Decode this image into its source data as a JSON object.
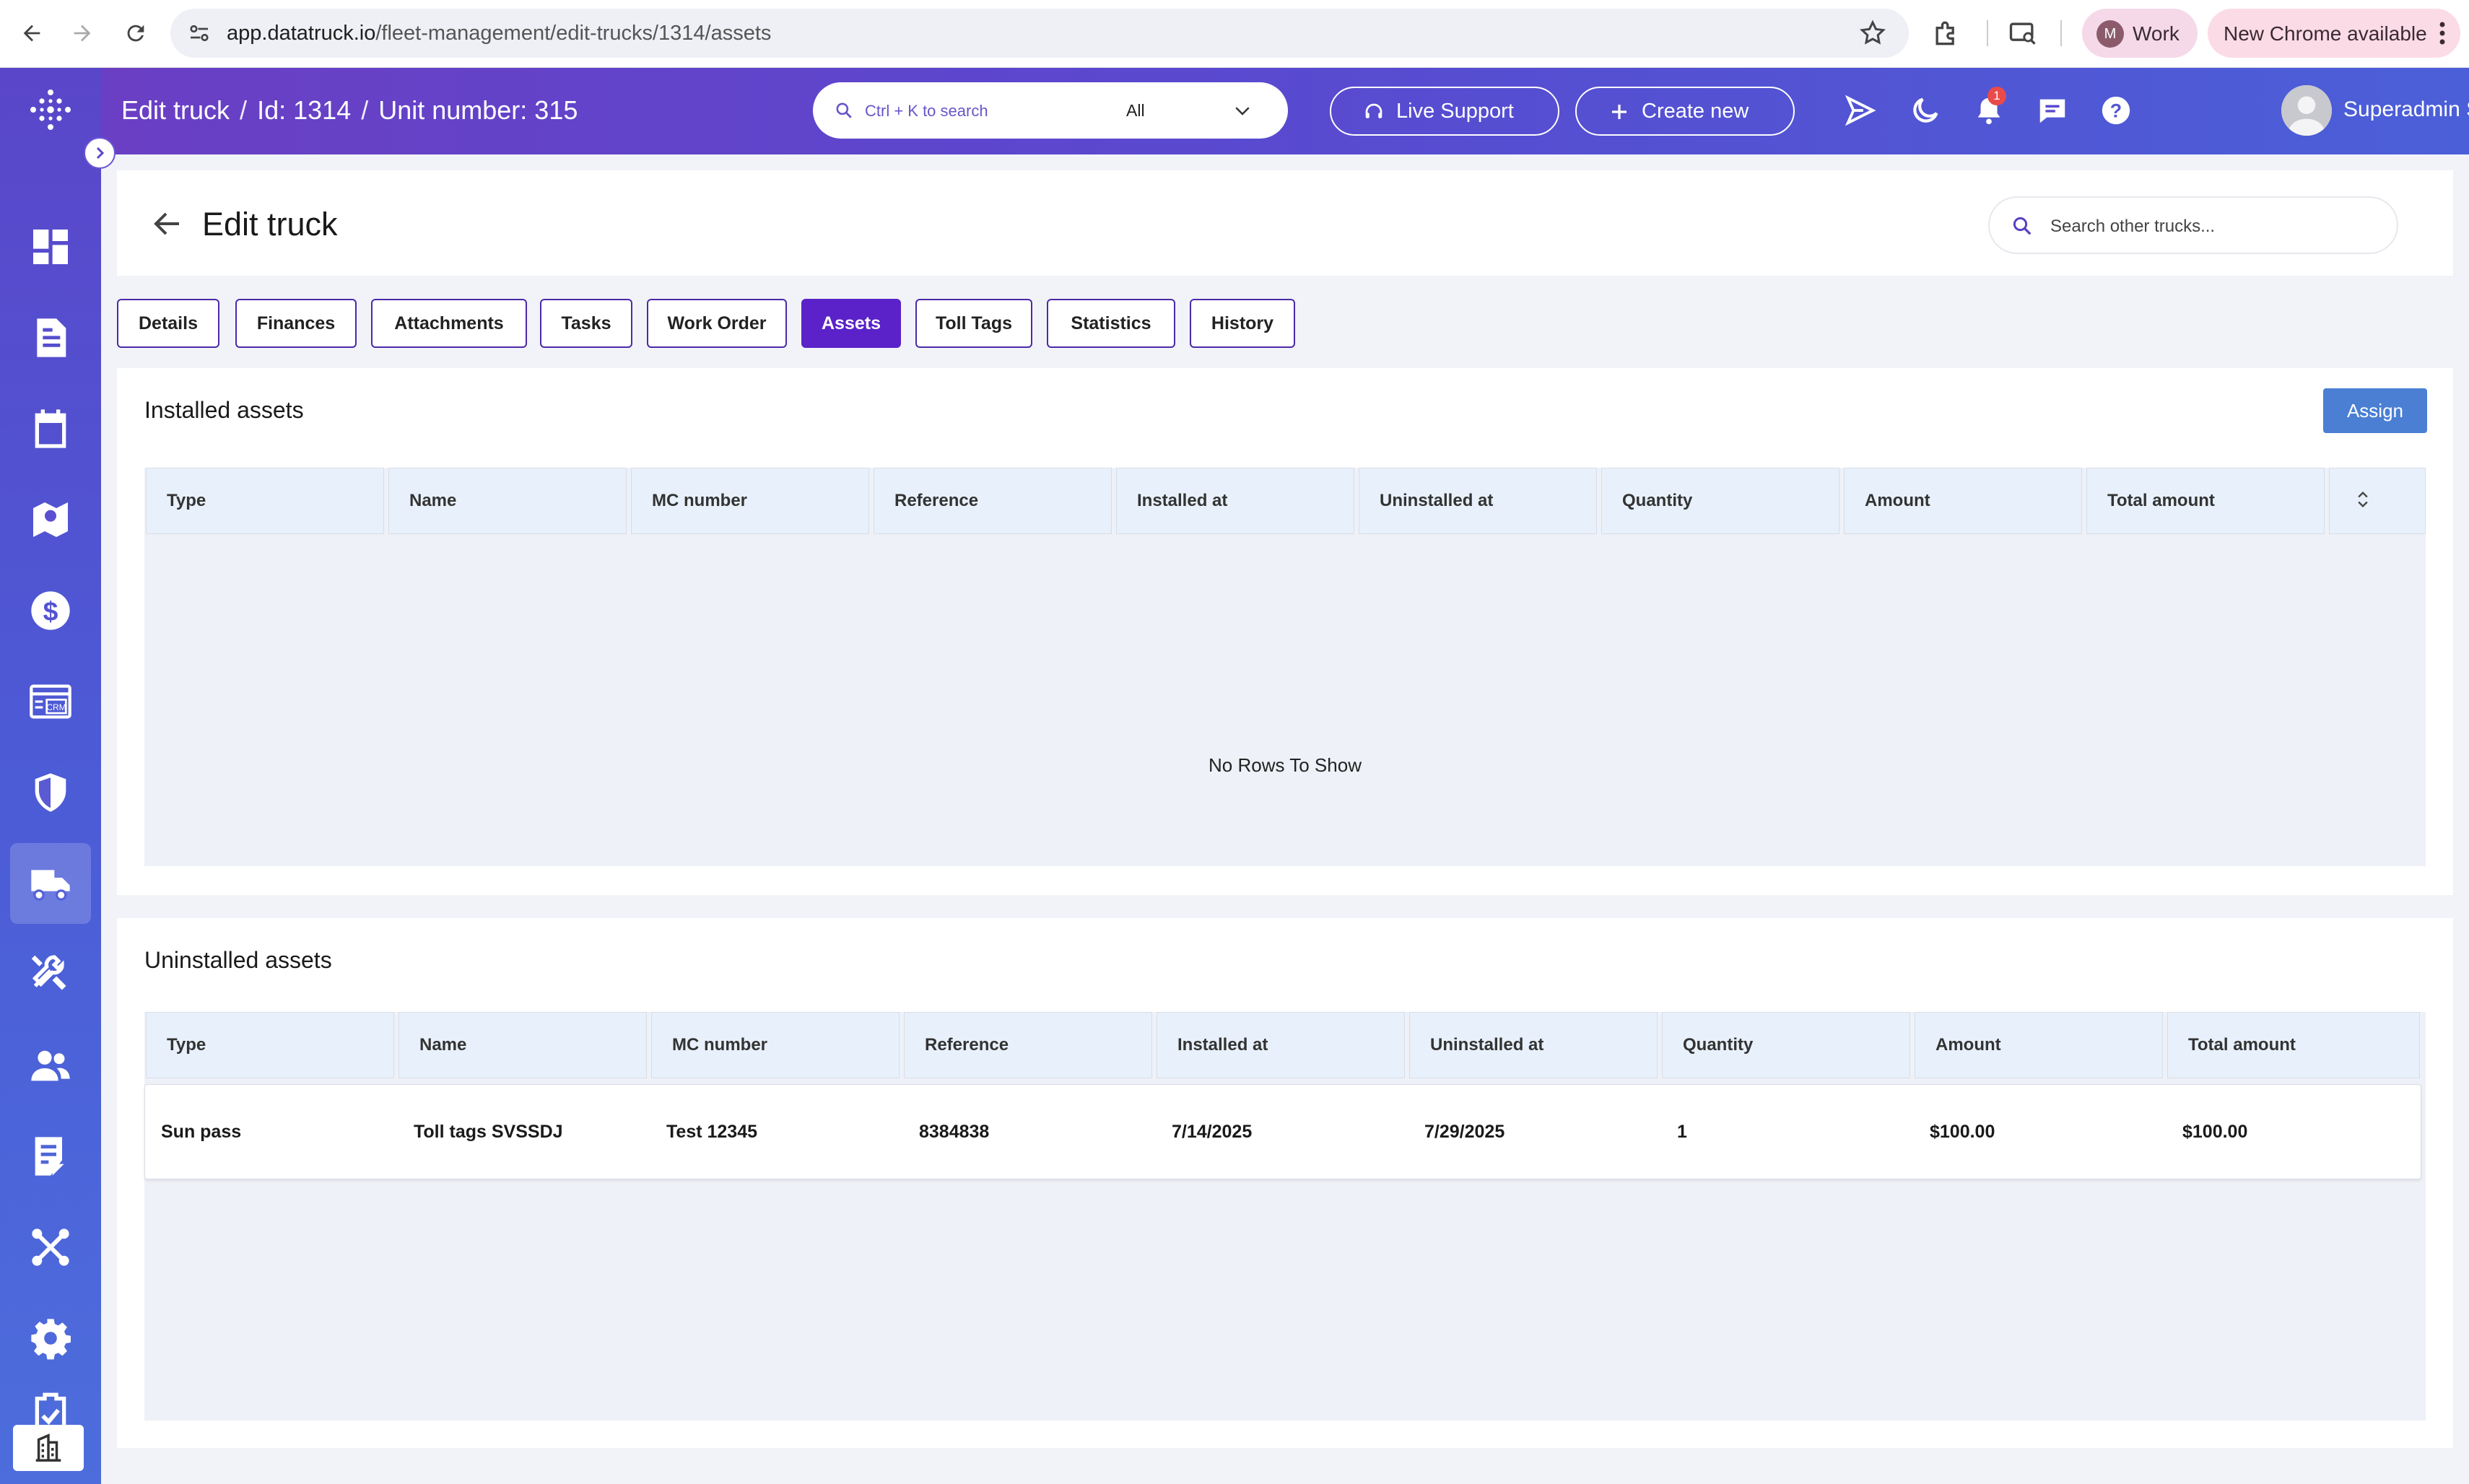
{
  "browser": {
    "url_host": "app.datatruck.io",
    "url_path": "/fleet-management/edit-trucks/1314/assets",
    "profile_initial": "M",
    "profile_label": "Work",
    "update_label": "New Chrome available"
  },
  "header": {
    "breadcrumb": [
      "Edit truck",
      "Id: 1314",
      "Unit number: 315"
    ],
    "search_placeholder": "Ctrl + K to search",
    "search_scope": "All",
    "live_support_label": "Live Support",
    "create_new_label": "Create new",
    "notification_count": "1",
    "user_name": "Superadmin Super"
  },
  "page": {
    "title": "Edit truck",
    "search_placeholder": "Search other trucks..."
  },
  "tabs": [
    {
      "label": "Details",
      "active": false
    },
    {
      "label": "Finances",
      "active": false
    },
    {
      "label": "Attachments",
      "active": false
    },
    {
      "label": "Tasks",
      "active": false
    },
    {
      "label": "Work Order",
      "active": false
    },
    {
      "label": "Assets",
      "active": true
    },
    {
      "label": "Toll Tags",
      "active": false
    },
    {
      "label": "Statistics",
      "active": false
    },
    {
      "label": "History",
      "active": false
    }
  ],
  "installed": {
    "title": "Installed assets",
    "assign_label": "Assign",
    "columns": [
      "Type",
      "Name",
      "MC number",
      "Reference",
      "Installed at",
      "Uninstalled at",
      "Quantity",
      "Amount",
      "Total amount"
    ],
    "empty_message": "No Rows To Show"
  },
  "uninstalled": {
    "title": "Uninstalled assets",
    "columns": [
      "Type",
      "Name",
      "MC number",
      "Reference",
      "Installed at",
      "Uninstalled at",
      "Quantity",
      "Amount",
      "Total amount"
    ],
    "rows": [
      [
        "Sun pass",
        "Toll tags SVSSDJ",
        "Test 12345",
        "8384838",
        "7/14/2025",
        "7/29/2025",
        "1",
        "$100.00",
        "$100.00"
      ]
    ]
  },
  "colors": {
    "accent": "#5a22c8",
    "header_start": "#6a3fc4",
    "header_end": "#4b5fd8",
    "assign_button": "#4a7fd4",
    "grid_header": "#e8f1fb"
  }
}
